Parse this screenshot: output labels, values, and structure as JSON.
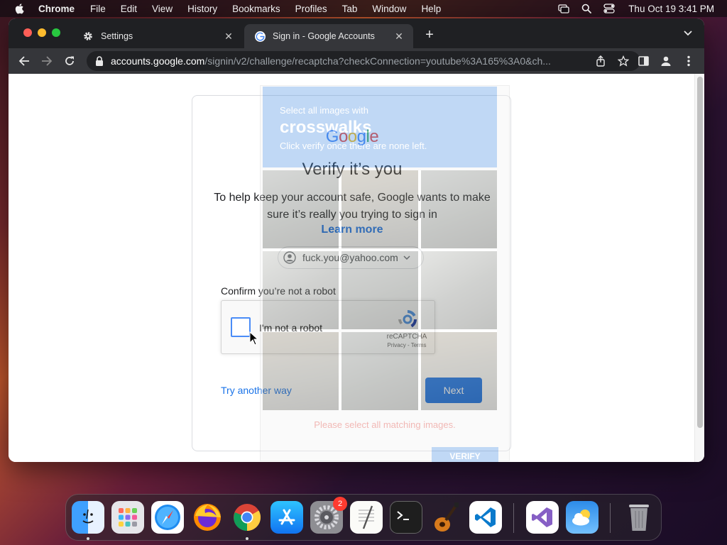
{
  "menubar": {
    "app_name": "Chrome",
    "items": [
      "File",
      "Edit",
      "View",
      "History",
      "Bookmarks",
      "Profiles",
      "Tab",
      "Window",
      "Help"
    ],
    "clock": "Thu Oct 19  3:41 PM"
  },
  "tabs": [
    {
      "title": "Settings",
      "icon": "gear-icon",
      "active": false
    },
    {
      "title": "Sign in - Google Accounts",
      "icon": "google-icon",
      "active": true
    }
  ],
  "omnibox": {
    "domain": "accounts.google.com",
    "path": "/signin/v2/challenge/recaptcha?checkConnection=youtube%3A165%3A0&ch..."
  },
  "card": {
    "logo": "Google",
    "title": "Verify it’s you",
    "description": "To help keep your account safe, Google wants to make sure it’s really you trying to sign in",
    "learn_more": "Learn more",
    "account": "fuck.you@yahoo.com",
    "confirm_label": "Confirm you’re not a robot",
    "recaptcha_label": "I'm not a robot",
    "recaptcha_brand": "reCAPTCHA",
    "recaptcha_links": "Privacy - Terms",
    "try_another": "Try another way",
    "next": "Next"
  },
  "challenge": {
    "select": "Select all images with",
    "target": "crosswalks",
    "hint": "Click verify once there are none left.",
    "error": "Please select all matching images.",
    "verify": "VERIFY"
  },
  "dock": {
    "apps": [
      "Finder",
      "Launchpad",
      "Safari",
      "Firefox",
      "Chrome",
      "App Store",
      "System Settings",
      "TextEdit",
      "Terminal",
      "GarageBand",
      "Visual Studio Code",
      "Visual Studio",
      "Weather",
      "Trash"
    ],
    "settings_badge": "2"
  },
  "colors": {
    "accent": "#1a73e8",
    "chrome_dark": "#35363a",
    "recaptcha_blue": "#4a90e2"
  }
}
